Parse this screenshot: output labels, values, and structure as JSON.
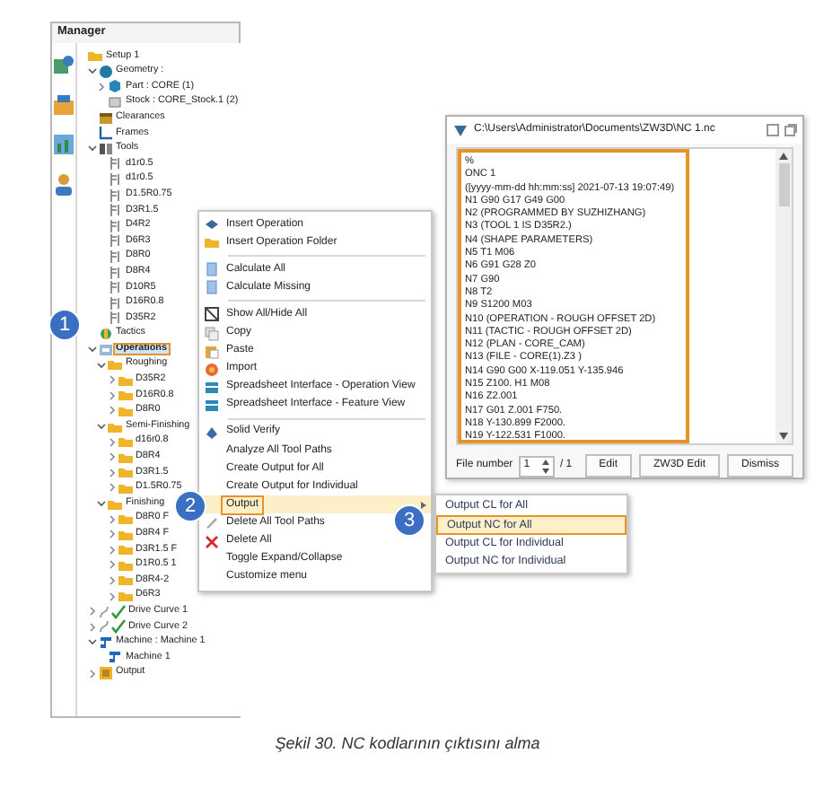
{
  "manager": {
    "title": "Manager",
    "tree": [
      {
        "label": "Setup 1",
        "kind": "setup",
        "selected": false,
        "children": [
          {
            "label": "Geometry :",
            "kind": "geometry",
            "expanded": true,
            "selected": false,
            "children": [
              {
                "label": "Part : CORE (1)",
                "kind": "part",
                "expanded": false,
                "selected": false
              },
              {
                "label": "Stock : CORE_Stock.1 (2)",
                "kind": "stock",
                "selected": false
              }
            ]
          },
          {
            "label": "Clearances",
            "kind": "clearances",
            "selected": false
          },
          {
            "label": "Frames",
            "kind": "frames",
            "selected": false
          },
          {
            "label": "Tools",
            "kind": "tools",
            "expanded": true,
            "selected": false,
            "children": [
              {
                "label": "d1r0.5",
                "kind": "tool",
                "selected": false
              },
              {
                "label": "d1r0.5",
                "kind": "tool",
                "selected": false
              },
              {
                "label": "D1.5R0.75",
                "kind": "tool",
                "selected": false
              },
              {
                "label": "D3R1.5",
                "kind": "tool",
                "selected": false
              },
              {
                "label": "D4R2",
                "kind": "tool",
                "selected": false
              },
              {
                "label": "D6R3",
                "kind": "tool",
                "selected": false
              },
              {
                "label": "D8R0",
                "kind": "tool",
                "selected": false
              },
              {
                "label": "D8R4",
                "kind": "tool",
                "selected": false
              },
              {
                "label": "D10R5",
                "kind": "tool",
                "selected": false
              },
              {
                "label": "D16R0.8",
                "kind": "tool",
                "selected": false
              },
              {
                "label": "D35R2",
                "kind": "tool",
                "selected": false
              }
            ]
          },
          {
            "label": "Tactics",
            "kind": "tactics",
            "selected": false
          },
          {
            "label": "Operations",
            "kind": "operations",
            "expanded": true,
            "selected": true,
            "children": [
              {
                "label": "Roughing",
                "kind": "folder",
                "expanded": true,
                "selected": false,
                "children": [
                  {
                    "label": "D35R2",
                    "kind": "folder",
                    "expanded": false,
                    "selected": false
                  },
                  {
                    "label": "D16R0.8",
                    "kind": "folder",
                    "expanded": false,
                    "selected": false
                  },
                  {
                    "label": "D8R0",
                    "kind": "folder",
                    "expanded": false,
                    "selected": false
                  }
                ]
              },
              {
                "label": "Semi-Finishing",
                "kind": "folder",
                "expanded": true,
                "selected": false,
                "children": [
                  {
                    "label": "d16r0.8",
                    "kind": "folder",
                    "expanded": false,
                    "selected": false
                  },
                  {
                    "label": "D8R4",
                    "kind": "folder",
                    "expanded": false,
                    "selected": false
                  },
                  {
                    "label": "D3R1.5",
                    "kind": "folder",
                    "expanded": false,
                    "selected": false
                  },
                  {
                    "label": "D1.5R0.75",
                    "kind": "folder",
                    "expanded": false,
                    "selected": false
                  }
                ]
              },
              {
                "label": "Finishing",
                "kind": "folder",
                "expanded": true,
                "selected": false,
                "children": [
                  {
                    "label": "D8R0 F",
                    "kind": "folder",
                    "expanded": false,
                    "selected": false
                  },
                  {
                    "label": "D8R4 F",
                    "kind": "folder",
                    "expanded": false,
                    "selected": false
                  },
                  {
                    "label": "D3R1.5 F",
                    "kind": "folder",
                    "expanded": false,
                    "selected": false
                  },
                  {
                    "label": "D1R0.5 1",
                    "kind": "folder",
                    "expanded": false,
                    "selected": false
                  },
                  {
                    "label": "D8R4-2",
                    "kind": "folder",
                    "expanded": false,
                    "selected": false
                  },
                  {
                    "label": "D6R3",
                    "kind": "folder",
                    "expanded": false,
                    "selected": false
                  }
                ]
              }
            ]
          },
          {
            "label": "Drive Curve 1",
            "kind": "curve",
            "expanded": false,
            "selected": false
          },
          {
            "label": "Drive Curve 2",
            "kind": "curve",
            "expanded": false,
            "selected": false
          },
          {
            "label": "Machine : Machine 1",
            "kind": "machine",
            "expanded": true,
            "selected": false,
            "children": [
              {
                "label": "Machine 1",
                "kind": "machine",
                "selected": false
              }
            ]
          },
          {
            "label": "Output",
            "kind": "output",
            "expanded": false,
            "selected": false
          }
        ]
      }
    ]
  },
  "context_menu": [
    {
      "kind": "item",
      "label": "Insert Operation",
      "selected": false
    },
    {
      "kind": "item",
      "label": "Insert Operation Folder",
      "selected": false
    },
    {
      "kind": "separator"
    },
    {
      "kind": "item",
      "label": "Calculate All",
      "selected": false
    },
    {
      "kind": "item",
      "label": "Calculate Missing",
      "selected": false
    },
    {
      "kind": "separator"
    },
    {
      "kind": "item",
      "label": "Show All/Hide All",
      "selected": false
    },
    {
      "kind": "item",
      "label": "Copy",
      "selected": false
    },
    {
      "kind": "item",
      "label": "Paste",
      "selected": false
    },
    {
      "kind": "item",
      "label": "Import",
      "selected": false
    },
    {
      "kind": "item",
      "label": "Spreadsheet Interface - Operation View",
      "selected": false
    },
    {
      "kind": "item",
      "label": "Spreadsheet Interface - Feature View",
      "selected": false
    },
    {
      "kind": "separator"
    },
    {
      "kind": "item",
      "label": "Solid Verify",
      "selected": false
    },
    {
      "kind": "item",
      "label": "Analyze All Tool Paths",
      "selected": false
    },
    {
      "kind": "item",
      "label": "Create Output for All",
      "selected": false
    },
    {
      "kind": "item",
      "label": "Create Output for Individual",
      "selected": false
    },
    {
      "kind": "item",
      "label": "Output",
      "selected": true
    },
    {
      "kind": "item",
      "label": "Delete All Tool Paths",
      "selected": false
    },
    {
      "kind": "item",
      "label": "Delete All",
      "selected": false
    },
    {
      "kind": "item",
      "label": "Toggle Expand/Collapse",
      "selected": false
    },
    {
      "kind": "item",
      "label": "Customize menu",
      "selected": false
    }
  ],
  "submenu": [
    {
      "label": "Output CL for All",
      "selected": false
    },
    {
      "label": "Output NC for All",
      "selected": true
    },
    {
      "label": "Output CL for Individual",
      "selected": false
    },
    {
      "label": "Output NC for Individual",
      "selected": false
    }
  ],
  "nc_window": {
    "title": "C:\\Users\\Administrator\\Documents\\ZW3D\\NC 1.nc",
    "lines": [
      "%",
      "ONC 1",
      "([yyyy-mm-dd hh:mm:ss] 2021-07-13 19:07:49)",
      "N1 G90 G17 G49 G00",
      "N2 (PROGRAMMED BY SUZHIZHANG)",
      "N3 (TOOL 1 IS D35R2.)",
      "N4 (SHAPE PARAMETERS)",
      "N5 T1 M06",
      "N6 G91 G28 Z0",
      "N7 G90",
      "N8 T2",
      "N9 S1200 M03",
      "N10 (OPERATION - ROUGH OFFSET 2D)",
      "N11 (TACTIC - ROUGH OFFSET 2D)",
      "N12 (PLAN - CORE_CAM)",
      "N13 (FILE - CORE(1).Z3 )",
      "N14 G90 G00 X-119.051 Y-135.946",
      "N15 Z100. H1 M08",
      "N16 Z2.001",
      "N17 G01 Z.001 F750.",
      "N18 Y-130.899 F2000.",
      "N19 Y-122.531 F1000."
    ],
    "file_number_label": "File number",
    "file_number": "1",
    "file_total": "/ 1",
    "buttons": [
      "Edit",
      "ZW3D Edit",
      "Dismiss"
    ]
  },
  "callouts": [
    "1",
    "2",
    "3"
  ],
  "caption": "Şekil 30. NC kodlarının çıktısını alma"
}
